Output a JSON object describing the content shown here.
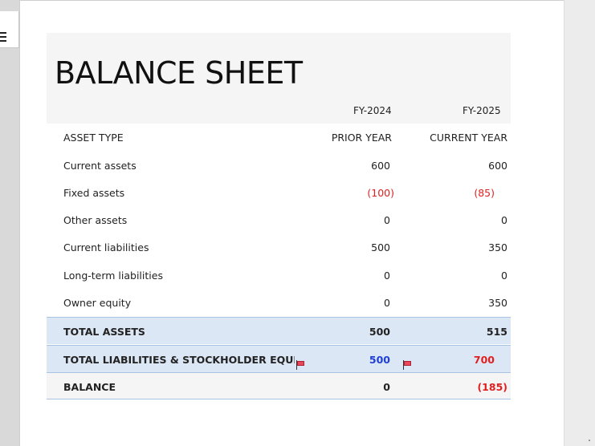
{
  "sheet": {
    "title": "BALANCE SHEET",
    "fy_prior": "FY-2024",
    "fy_current": "FY-2025"
  },
  "header_row": {
    "label": "ASSET TYPE",
    "prior": "PRIOR YEAR",
    "current": "CURRENT YEAR"
  },
  "rows": [
    {
      "label": "Current assets",
      "prior": "600",
      "current": "600"
    },
    {
      "label": "Fixed assets",
      "prior": "(100)",
      "current": "(85)"
    },
    {
      "label": "Other assets",
      "prior": "0",
      "current": "0"
    },
    {
      "label": "Current liabilities",
      "prior": "500",
      "current": "350"
    },
    {
      "label": "Long-term liabilities",
      "prior": "0",
      "current": "0"
    },
    {
      "label": "Owner equity",
      "prior": "0",
      "current": "350"
    }
  ],
  "totals": {
    "assets": {
      "label": "TOTAL ASSETS",
      "prior": "500",
      "current": "515"
    },
    "liabilities": {
      "label": "TOTAL LIABILITIES & STOCKHOLDER EQUIT",
      "prior": "500",
      "current": "700"
    },
    "balance": {
      "label": "BALANCE",
      "prior": "0",
      "current": "(185)"
    }
  },
  "icons": {
    "menu": "hamburger-menu-icon",
    "flag": "flag-icon"
  },
  "colors": {
    "negative": "#e02020",
    "highlight_blue": "#1f3fd6",
    "total_band": "#dbe7f4"
  }
}
